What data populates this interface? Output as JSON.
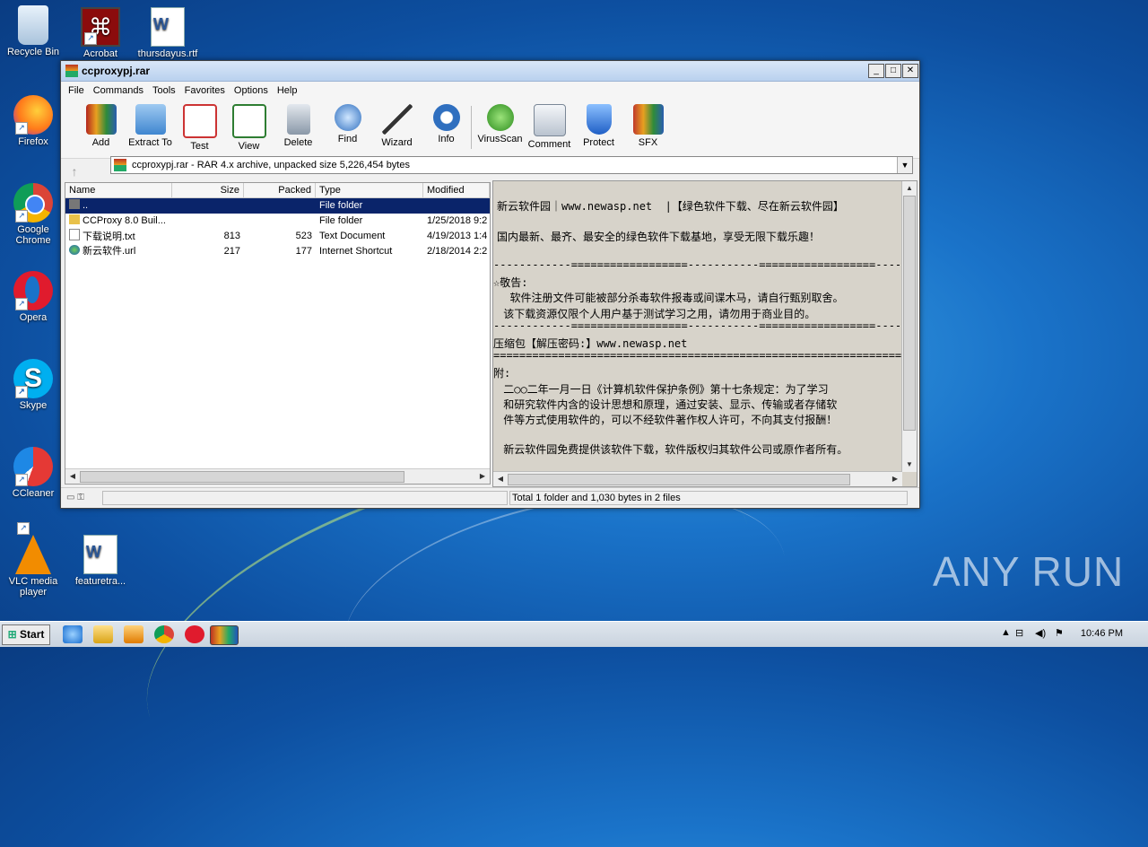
{
  "desktop_icons": [
    {
      "label": "Recycle Bin"
    },
    {
      "label": "Acrobat"
    },
    {
      "label": "thursdayus.rtf"
    },
    {
      "label": "Firefox"
    },
    {
      "label": "Google Chrome"
    },
    {
      "label": "Opera"
    },
    {
      "label": "Skype"
    },
    {
      "label": "CCleaner"
    },
    {
      "label": "VLC media player"
    },
    {
      "label": "featuretra..."
    }
  ],
  "window": {
    "title": "ccproxypj.rar",
    "menu": [
      "File",
      "Commands",
      "Tools",
      "Favorites",
      "Options",
      "Help"
    ],
    "toolbar": [
      "Add",
      "Extract To",
      "Test",
      "View",
      "Delete",
      "Find",
      "Wizard",
      "Info",
      "VirusScan",
      "Comment",
      "Protect",
      "SFX"
    ],
    "address": "ccproxypj.rar - RAR 4.x archive, unpacked size 5,226,454 bytes",
    "columns": [
      "Name",
      "Size",
      "Packed",
      "Type",
      "Modified"
    ],
    "rows": [
      {
        "name": "..",
        "size": "",
        "packed": "",
        "type": "File folder",
        "modified": ""
      },
      {
        "name": "CCProxy 8.0 Buil...",
        "size": "",
        "packed": "",
        "type": "File folder",
        "modified": "1/25/2018 9:2"
      },
      {
        "name": "下载说明.txt",
        "size": "813",
        "packed": "523",
        "type": "Text Document",
        "modified": "4/19/2013 1:4"
      },
      {
        "name": "新云软件.url",
        "size": "217",
        "packed": "177",
        "type": "Internet Shortcut",
        "modified": "2/18/2014 2:2"
      }
    ],
    "comment_lines": [
      "新云软件园｜www.newasp.net  |【绿色软件下载、尽在新云软件园】",
      "国内最新、最齐、最安全的绿色软件下载基地，享受无限下载乐趣！",
      "------------==================-----------==================----",
      "☆敬告:",
      "  软件注册文件可能被部分杀毒软件报毒或间谍木马，请自行甄别取舍。",
      " 该下载资源仅限个人用户基于测试学习之用，请勿用于商业目的。",
      "------------==================-----------==================----",
      "压缩包【解压密码:】www.newasp.net",
      "================================================================",
      "附:",
      " 二○○二年一月一日《计算机软件保护条例》第十七条规定：为了学习",
      " 和研究软件内含的设计思想和原理，通过安装、显示、传输或者存储软",
      " 件等方式使用软件的，可以不经软件著作权人许可，不向其支付报酬！",
      " 新云软件园免费提供该软件下载，软件版权归其软件公司或原作者所有。"
    ],
    "status": "Total 1 folder and 1,030 bytes in 2 files"
  },
  "taskbar": {
    "start": "Start",
    "clock": "10:46 PM"
  },
  "watermark": "ANY RUN"
}
